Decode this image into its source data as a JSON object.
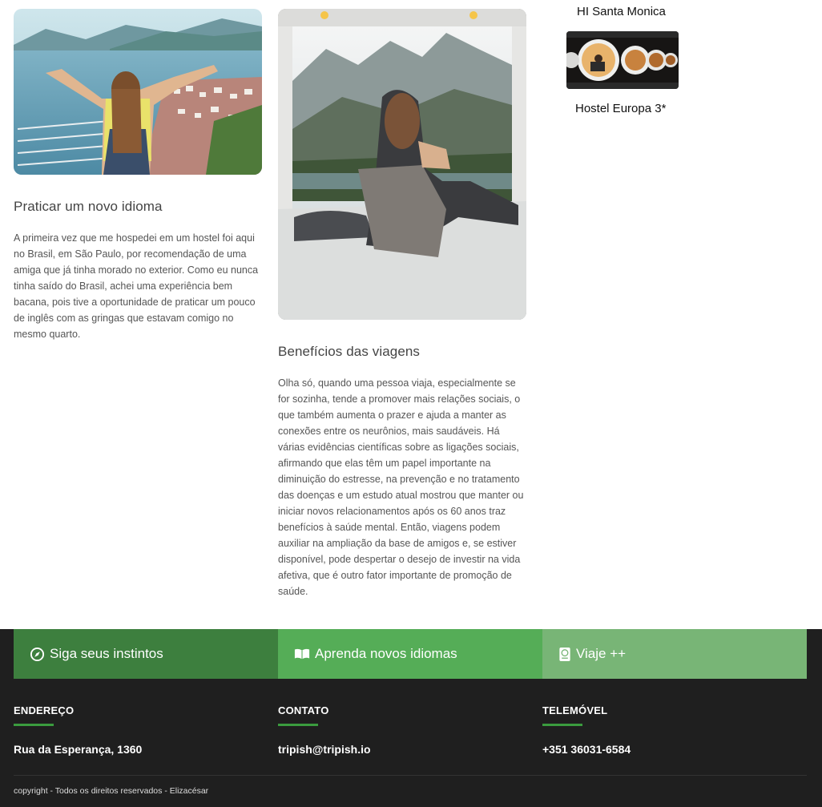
{
  "article1": {
    "title": "Praticar um novo idioma",
    "body": "A primeira vez que me hospedei em um hostel foi aqui no Brasil, em São Paulo, por recomendação de uma amiga que já tinha morado no exterior. Como eu nunca tinha saído do Brasil, achei uma experiência bem bacana, pois tive a oportunidade de praticar um pouco de inglês com as gringas que estavam comigo no mesmo quarto."
  },
  "article2": {
    "title": "Benefícios das viagens",
    "body": "Olha só, quando uma pessoa viaja, especialmente se for sozinha, tende a promover mais relações sociais, o que também aumenta o prazer e ajuda a manter as conexões entre os neurônios, mais saudáveis. Há várias evidências científicas sobre as ligações sociais, afirmando que elas têm um papel importante na diminuição do estresse, na prevenção e no tratamento das doenças e um estudo atual mostrou que manter ou iniciar novos relacionamentos após os 60 anos traz benefícios à saúde mental. Então, viagens podem auxiliar na ampliação da base de amigos e, se estiver disponível, pode despertar o desejo de investir na vida afetiva, que é outro fator importante de promoção de saúde."
  },
  "sidebar": {
    "hostel1": "HI Santa Monica",
    "hostel2": "Hostel Europa 3*"
  },
  "features": [
    {
      "label": "Siga seus instintos",
      "icon": "compass-icon",
      "color": "#3d7f3e"
    },
    {
      "label": "Aprenda novos idiomas",
      "icon": "book-open-icon",
      "color": "#55ad57"
    },
    {
      "label": "Viaje ++",
      "icon": "passport-icon",
      "color": "#78b576"
    }
  ],
  "footer": {
    "address_heading": "ENDEREÇO",
    "address": "Rua da Esperança, 1360",
    "contact_heading": "CONTATO",
    "contact": "tripish@tripish.io",
    "phone_heading": "TELEMÓVEL",
    "phone": "+351 36031-6584",
    "copyright": "copyright - Todos os direitos reservados - Elizacésar"
  }
}
